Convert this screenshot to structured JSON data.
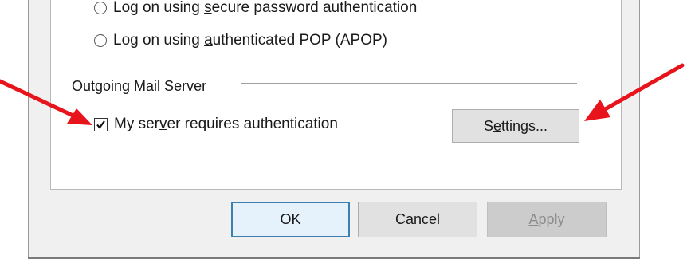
{
  "auth_options": [
    {
      "pre": "Log on using ",
      "ul": "s",
      "post": "ecure password authentication",
      "selected": false
    },
    {
      "pre": "Log on using ",
      "ul": "a",
      "post": "uthenticated POP (APOP)",
      "selected": false
    }
  ],
  "outgoing": {
    "group_label": "Outgoing Mail Server",
    "checkbox": {
      "pre": "My ser",
      "ul": "v",
      "post": "er requires authentication",
      "checked": true
    },
    "settings_button": {
      "pre": "S",
      "ul": "e",
      "post": "ttings..."
    }
  },
  "buttons": {
    "ok": "OK",
    "cancel": "Cancel",
    "apply": {
      "ul": "A",
      "post": "pply",
      "enabled": false
    }
  },
  "colors": {
    "annotation_arrow": "#e8141b",
    "ok_focus_border": "#3c7fb1"
  },
  "annotations": [
    "red-arrow-to-checkbox",
    "red-arrow-to-settings-button"
  ]
}
